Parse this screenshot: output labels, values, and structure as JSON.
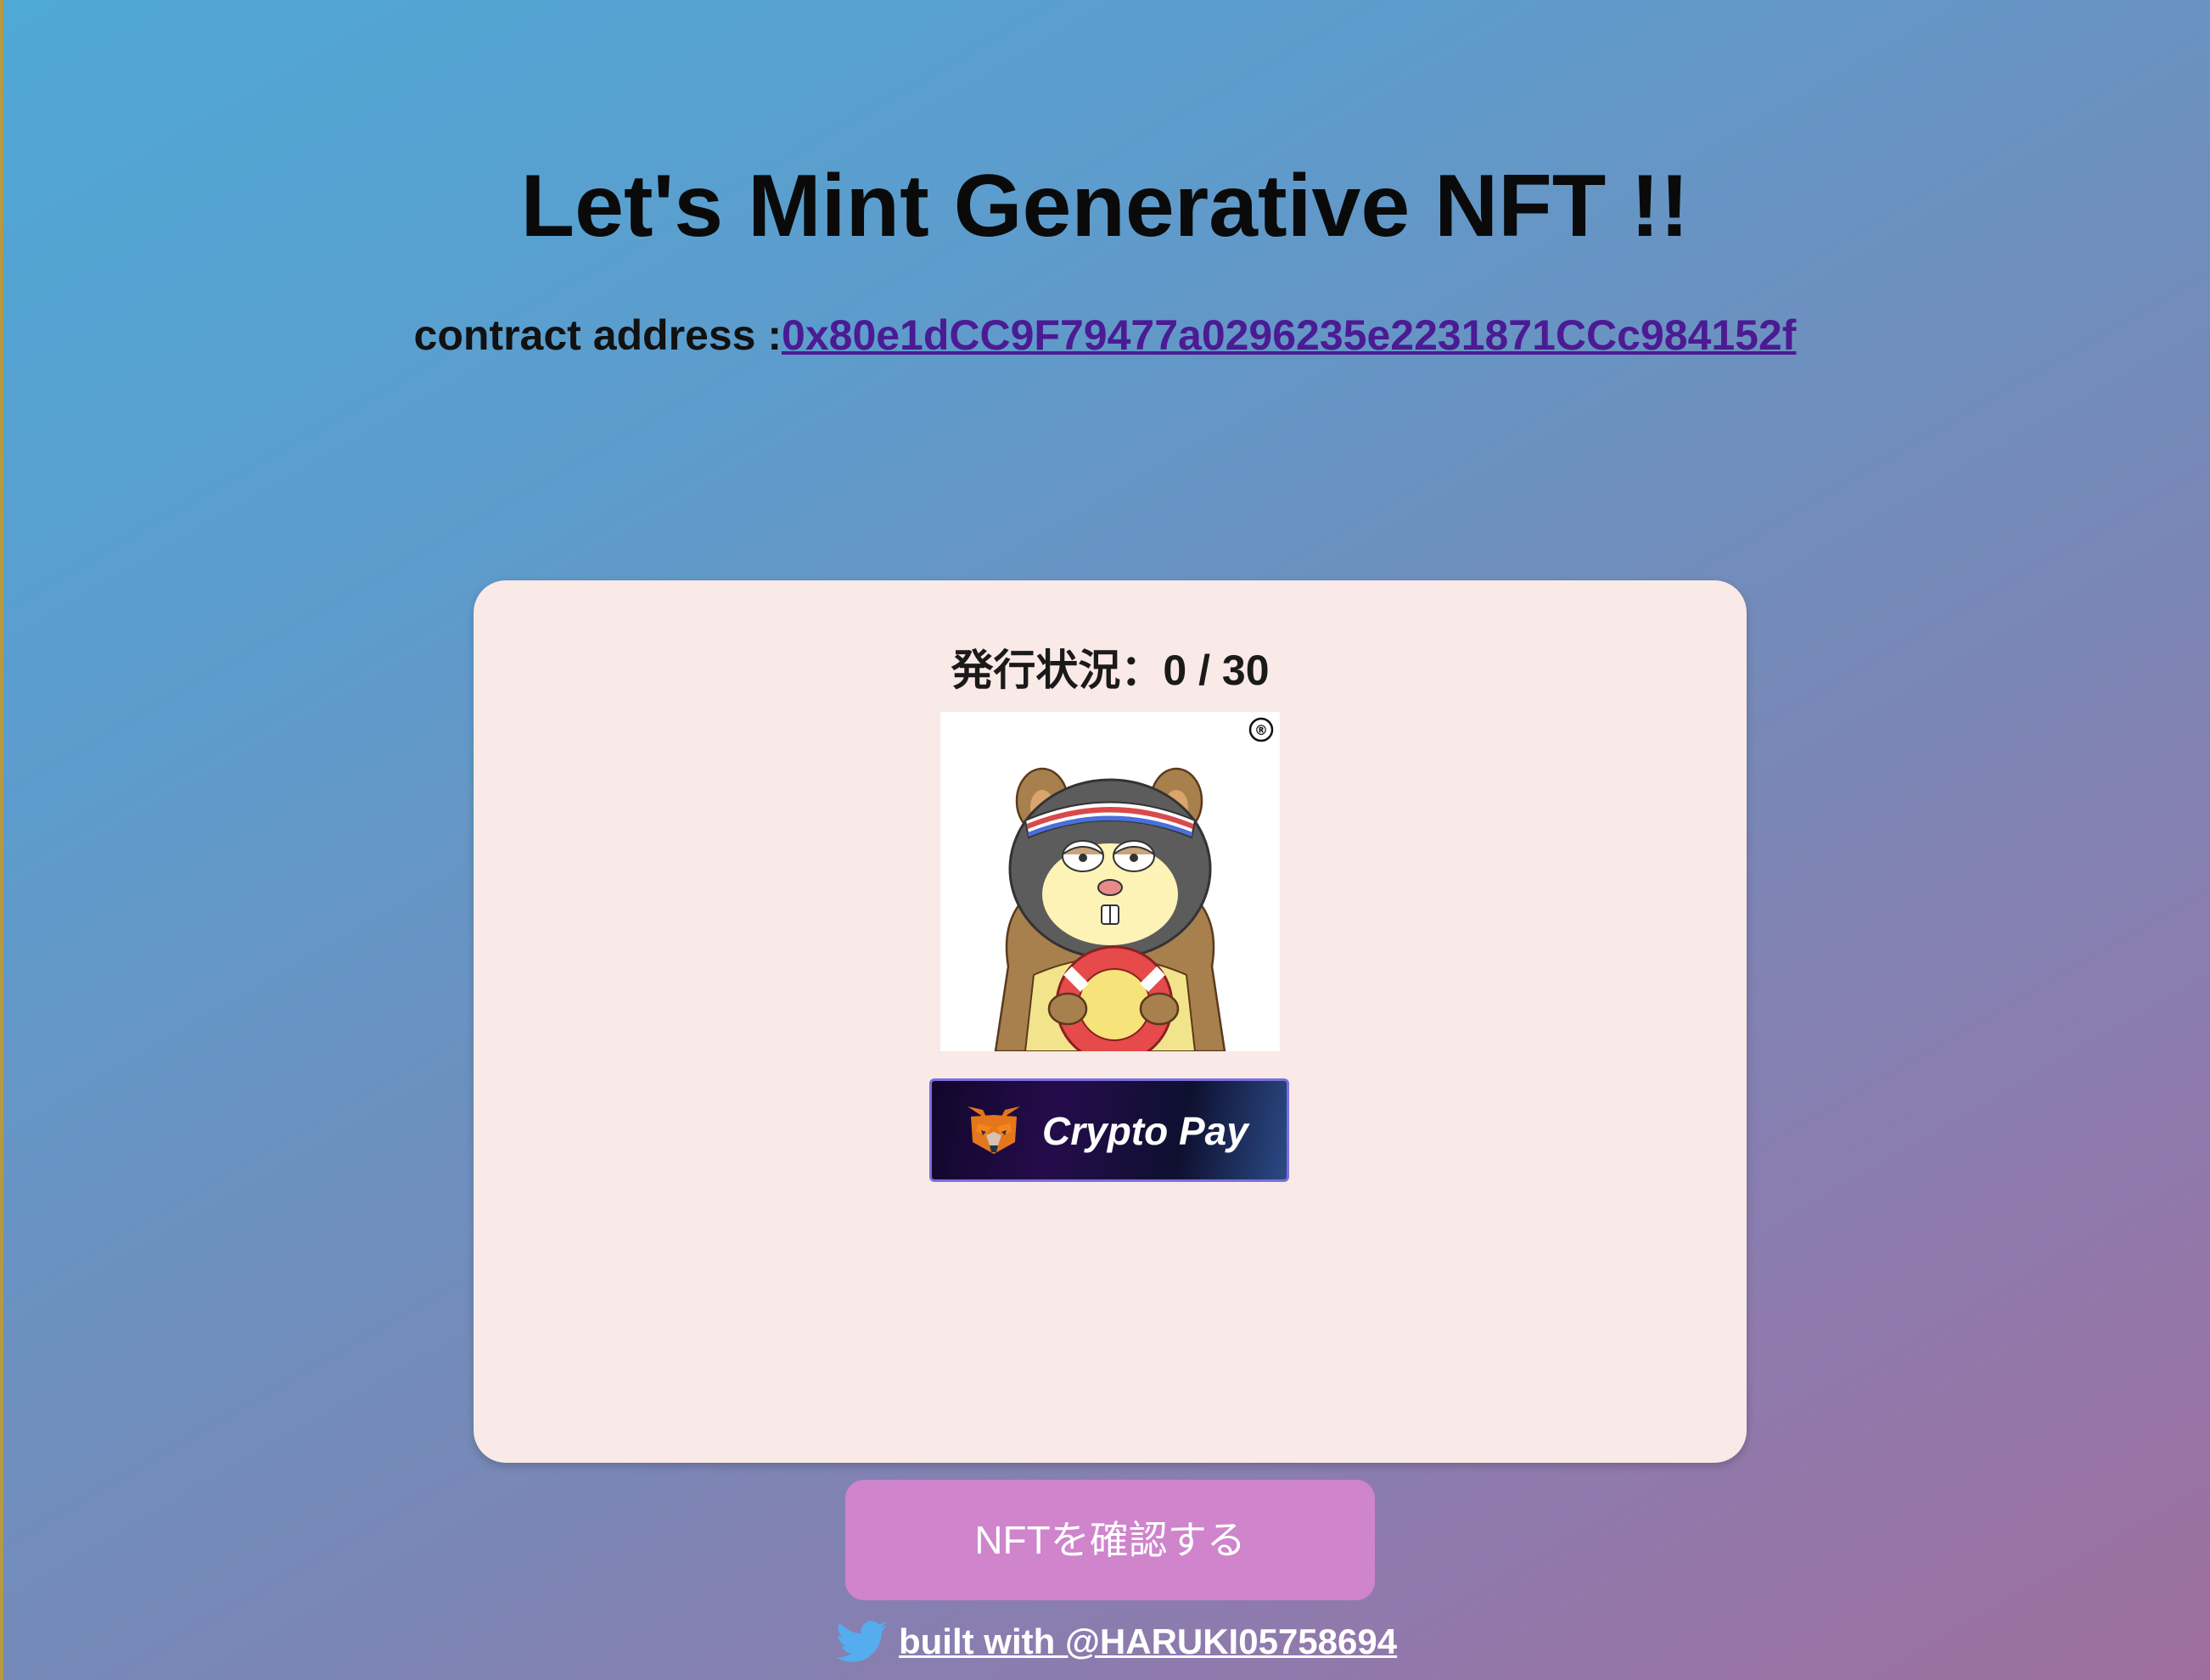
{
  "header": {
    "title": "Let's Mint Generative NFT !!",
    "contract_label": "contract address :",
    "contract_address": "0x80e1dCC9F79477a0296235e2231871CCc984152f"
  },
  "card": {
    "status": "発行状況：0 / 30",
    "nft_image": "hamster-nft-icon",
    "registered_mark": "®",
    "pay_button_label": "Crypto Pay"
  },
  "confirm_button_label": "NFTを確認する",
  "footer": {
    "link_text": "built with @HARUKI05758694",
    "icon": "twitter-icon"
  },
  "colors": {
    "link": "#4b1b93",
    "card": "#f9e9e7",
    "confirm_button": "#cf84cc",
    "twitter": "#55acee"
  }
}
